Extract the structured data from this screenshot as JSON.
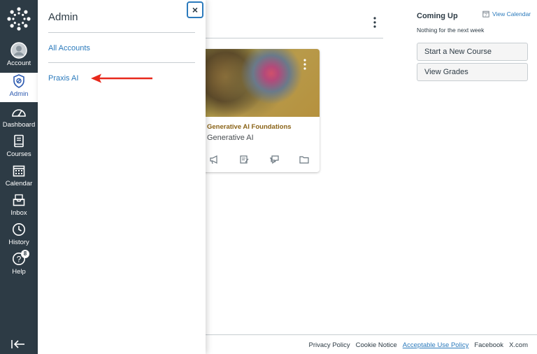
{
  "global_nav": {
    "items": [
      {
        "label": "Account",
        "icon": "account-avatar-icon"
      },
      {
        "label": "Admin",
        "icon": "shield-icon",
        "active": true
      },
      {
        "label": "Dashboard",
        "icon": "speedometer-icon"
      },
      {
        "label": "Courses",
        "icon": "book-icon"
      },
      {
        "label": "Calendar",
        "icon": "calendar-icon"
      },
      {
        "label": "Inbox",
        "icon": "inbox-icon"
      },
      {
        "label": "History",
        "icon": "clock-icon"
      },
      {
        "label": "Help",
        "icon": "help-icon",
        "badge": "8"
      }
    ],
    "background": "#2d3b45"
  },
  "admin_tray": {
    "title": "Admin",
    "close_label": "×",
    "links": [
      "All Accounts",
      "Praxis AI"
    ]
  },
  "course_card": {
    "code": "Generative AI Foundations",
    "name": "Generative AI"
  },
  "sidebar": {
    "coming_up": "Coming Up",
    "view_calendar": "View Calendar",
    "nothing": "Nothing for the next week",
    "buttons": [
      "Start a New Course",
      "View Grades"
    ]
  },
  "footer": {
    "links": [
      "Privacy Policy",
      "Cookie Notice",
      "Acceptable Use Policy",
      "Facebook",
      "X.com"
    ]
  },
  "colors": {
    "link": "#2b7abc",
    "nav": "#2d3b45",
    "arrow": "#e8291c",
    "course_code": "#8b6418"
  }
}
